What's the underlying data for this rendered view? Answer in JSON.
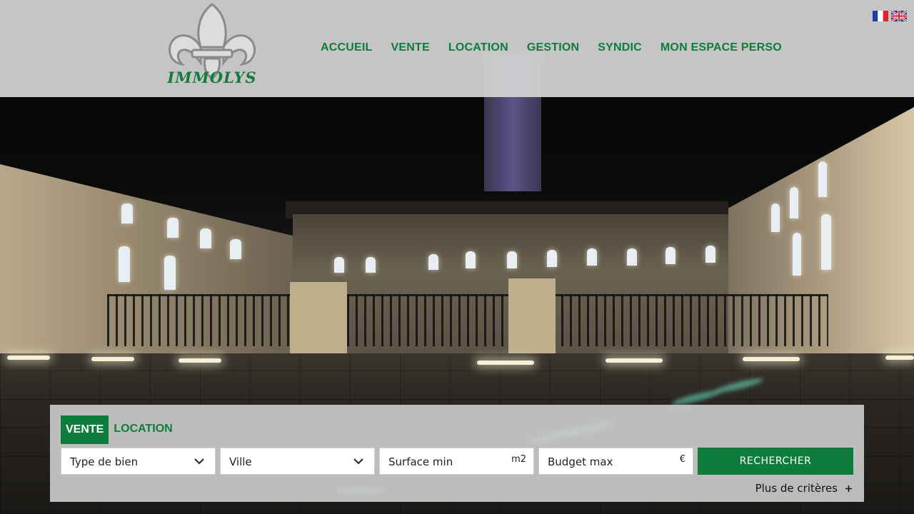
{
  "brand": {
    "logo_text": "IMMOLYS",
    "icon": "fleur-de-lis-icon",
    "color": "#157a3b"
  },
  "nav": {
    "items": [
      {
        "label": "ACCUEIL"
      },
      {
        "label": "VENTE"
      },
      {
        "label": "LOCATION"
      },
      {
        "label": "GESTION"
      },
      {
        "label": "SYNDIC"
      },
      {
        "label": "MON ESPACE PERSO"
      }
    ],
    "color": "#0e7c3a"
  },
  "languages": [
    {
      "icon": "french-flag-icon"
    },
    {
      "icon": "english-flag-icon"
    }
  ],
  "search": {
    "tabs": [
      {
        "label": "VENTE",
        "active": true
      },
      {
        "label": "LOCATION",
        "active": false
      }
    ],
    "property_type": {
      "label": "Type de bien",
      "icon": "chevron-down-icon"
    },
    "city": {
      "label": "Ville",
      "icon": "chevron-down-icon"
    },
    "surface": {
      "placeholder": "Surface min",
      "unit": "m2"
    },
    "budget": {
      "placeholder": "Budget max",
      "unit": "€"
    },
    "submit_label": "RECHERCHER",
    "more_label": "Plus de critères",
    "more_icon": "plus-icon",
    "accent": "#0e7c3a"
  }
}
